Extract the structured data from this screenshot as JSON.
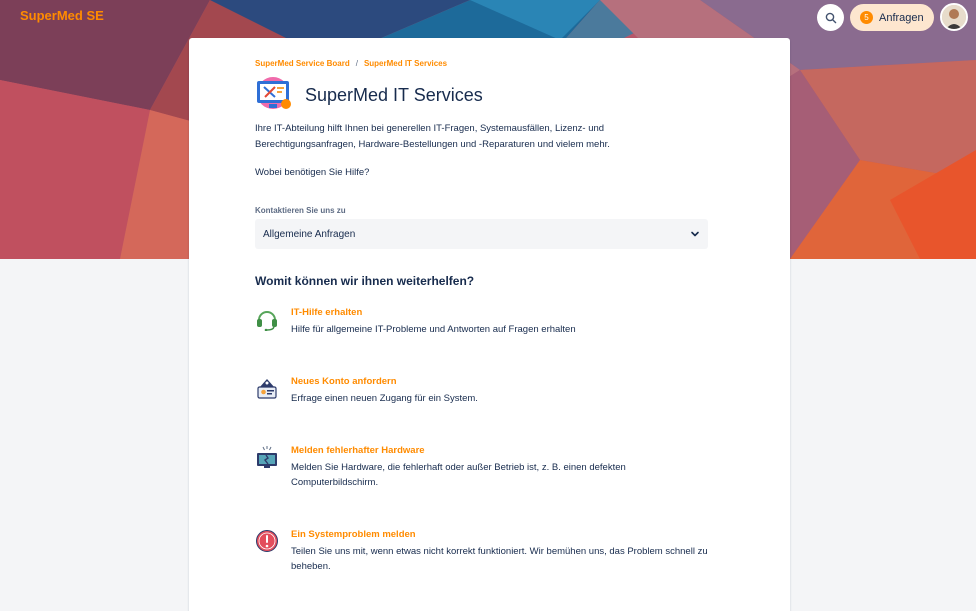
{
  "header": {
    "brand": "SuperMed SE",
    "requests_count": "5",
    "requests_label": "Anfragen",
    "accent_color": "#ff8b00"
  },
  "breadcrumb": {
    "items": [
      "SuperMed Service Board",
      "SuperMed IT Services"
    ],
    "separator": "/"
  },
  "portal": {
    "title": "SuperMed IT Services",
    "description": "Ihre IT-Abteilung hilft Ihnen bei generellen IT-Fragen, Systemausfällen, Lizenz- und Berechtigungsanfragen, Hardware-Bestellungen und -Reparaturen und vielem mehr.",
    "help_question": "Wobei benötigen Sie Hilfe?",
    "contact_label": "Kontaktieren Sie uns zu",
    "contact_selected": "Allgemeine Anfragen",
    "section_title": "Womit können wir ihnen weiterhelfen?"
  },
  "options": [
    {
      "icon": "headset-icon",
      "title": "IT-Hilfe erhalten",
      "description": "Hilfe für allgemeine IT-Probleme und Antworten auf Fragen erhalten"
    },
    {
      "icon": "account-card-icon",
      "title": "Neues Konto anfordern",
      "description": "Erfrage einen neuen Zugang für ein System."
    },
    {
      "icon": "broken-hardware-icon",
      "title": "Melden fehlerhafter Hardware",
      "description": "Melden Sie Hardware, die fehlerhaft oder außer Betrieb ist, z. B. einen defekten Computerbildschirm."
    },
    {
      "icon": "warning-icon",
      "title": "Ein Systemproblem melden",
      "description": "Teilen Sie uns mit, wenn etwas nicht korrekt funktioniert. Wir bemühen uns, das Problem schnell zu beheben."
    }
  ]
}
